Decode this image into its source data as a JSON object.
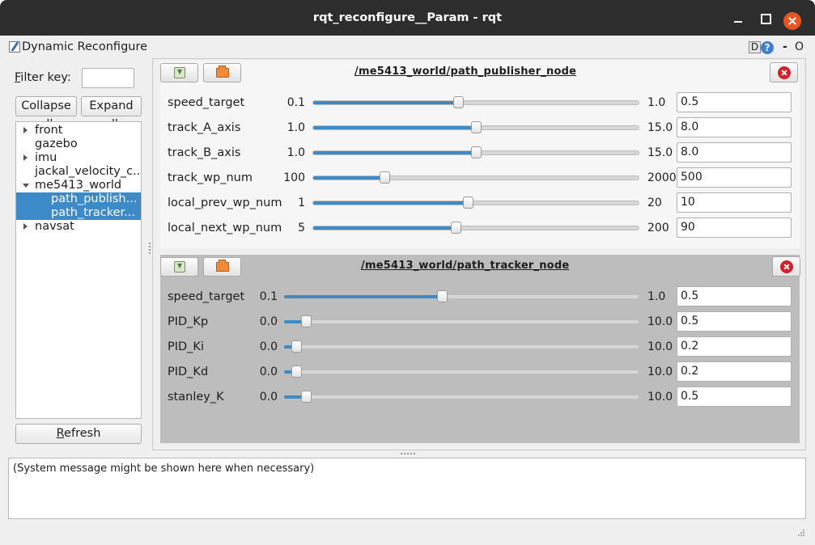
{
  "window": {
    "title": "rqt_reconfigure__Param - rqt"
  },
  "plugin": {
    "title": "Dynamic Reconfigure",
    "d_label": "D",
    "help_label": "?",
    "dash_label": "-",
    "o_label": "O"
  },
  "sidebar": {
    "filter_label": "Filter key:",
    "filter_value": "",
    "collapse_label": "Collapse all",
    "expand_label": "Expand all",
    "refresh_label_u": "R",
    "refresh_label_rest": "efresh",
    "tree": [
      {
        "label": "front",
        "level": 0,
        "arrow": "right",
        "selected": false
      },
      {
        "label": "gazebo",
        "level": 0,
        "arrow": "none",
        "selected": false
      },
      {
        "label": "imu",
        "level": 0,
        "arrow": "right",
        "selected": false
      },
      {
        "label": "jackal_velocity_c...",
        "level": 0,
        "arrow": "none",
        "selected": false
      },
      {
        "label": "me5413_world",
        "level": 0,
        "arrow": "down",
        "selected": false
      },
      {
        "label": "path_publish...",
        "level": 1,
        "arrow": "none",
        "selected": true
      },
      {
        "label": "path_tracker...",
        "level": 1,
        "arrow": "none",
        "selected": true
      },
      {
        "label": "navsat",
        "level": 0,
        "arrow": "right",
        "selected": false
      }
    ]
  },
  "nodes": [
    {
      "title": "/me5413_world/path_publisher_node",
      "params": [
        {
          "name": "speed_target",
          "min": "0.1",
          "max": "1.0",
          "value": "0.5",
          "fraction": 0.4444
        },
        {
          "name": "track_A_axis",
          "min": "1.0",
          "max": "15.0",
          "value": "8.0",
          "fraction": 0.5
        },
        {
          "name": "track_B_axis",
          "min": "1.0",
          "max": "15.0",
          "value": "8.0",
          "fraction": 0.5
        },
        {
          "name": "track_wp_num",
          "min": "100",
          "max": "2000",
          "value": "500",
          "fraction": 0.2105
        },
        {
          "name": "local_prev_wp_num",
          "min": "1",
          "max": "20",
          "value": "10",
          "fraction": 0.4737
        },
        {
          "name": "local_next_wp_num",
          "min": "5",
          "max": "200",
          "value": "90",
          "fraction": 0.4359
        }
      ]
    },
    {
      "title": "/me5413_world/path_tracker_node",
      "params": [
        {
          "name": "speed_target",
          "min": "0.1",
          "max": "1.0",
          "value": "0.5",
          "fraction": 0.4444
        },
        {
          "name": "PID_Kp",
          "min": "0.0",
          "max": "10.0",
          "value": "0.5",
          "fraction": 0.05
        },
        {
          "name": "PID_Ki",
          "min": "0.0",
          "max": "10.0",
          "value": "0.2",
          "fraction": 0.02
        },
        {
          "name": "PID_Kd",
          "min": "0.0",
          "max": "10.0",
          "value": "0.2",
          "fraction": 0.02
        },
        {
          "name": "stanley_K",
          "min": "0.0",
          "max": "10.0",
          "value": "0.5",
          "fraction": 0.05
        }
      ]
    }
  ],
  "message": "(System message might be shown here when necessary)"
}
